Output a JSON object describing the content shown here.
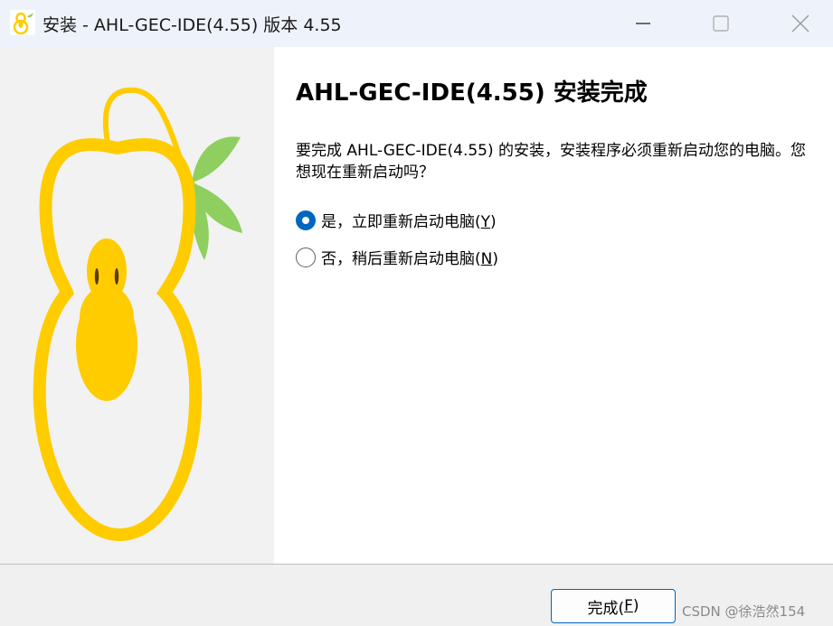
{
  "window": {
    "title": "安装 - AHL-GEC-IDE(4.55) 版本 4.55",
    "icon": "gourd-logo-icon",
    "controls": [
      "minimize-icon",
      "maximize-icon",
      "close-icon"
    ]
  },
  "sidebar": {
    "image": "gourd-logo"
  },
  "main": {
    "heading": "AHL-GEC-IDE(4.55) 安装完成",
    "message": "要完成 AHL-GEC-IDE(4.55) 的安装，安装程序必须重新启动您的电脑。您想现在重新启动吗？",
    "options": [
      {
        "label_prefix": "是，立即重新启动电脑(",
        "accesskey": "Y",
        "label_suffix": ")",
        "checked": true
      },
      {
        "label_prefix": "否，稍后重新启动电脑(",
        "accesskey": "N",
        "label_suffix": ")",
        "checked": false
      }
    ]
  },
  "footer": {
    "finish_prefix": "完成(",
    "finish_accesskey": "F",
    "finish_suffix": ")",
    "watermark": "CSDN @徐浩然154"
  },
  "colors": {
    "accent": "#0067c0",
    "gourd_yellow": "#FFCC00",
    "leaf_green": "#8ECF5F"
  }
}
